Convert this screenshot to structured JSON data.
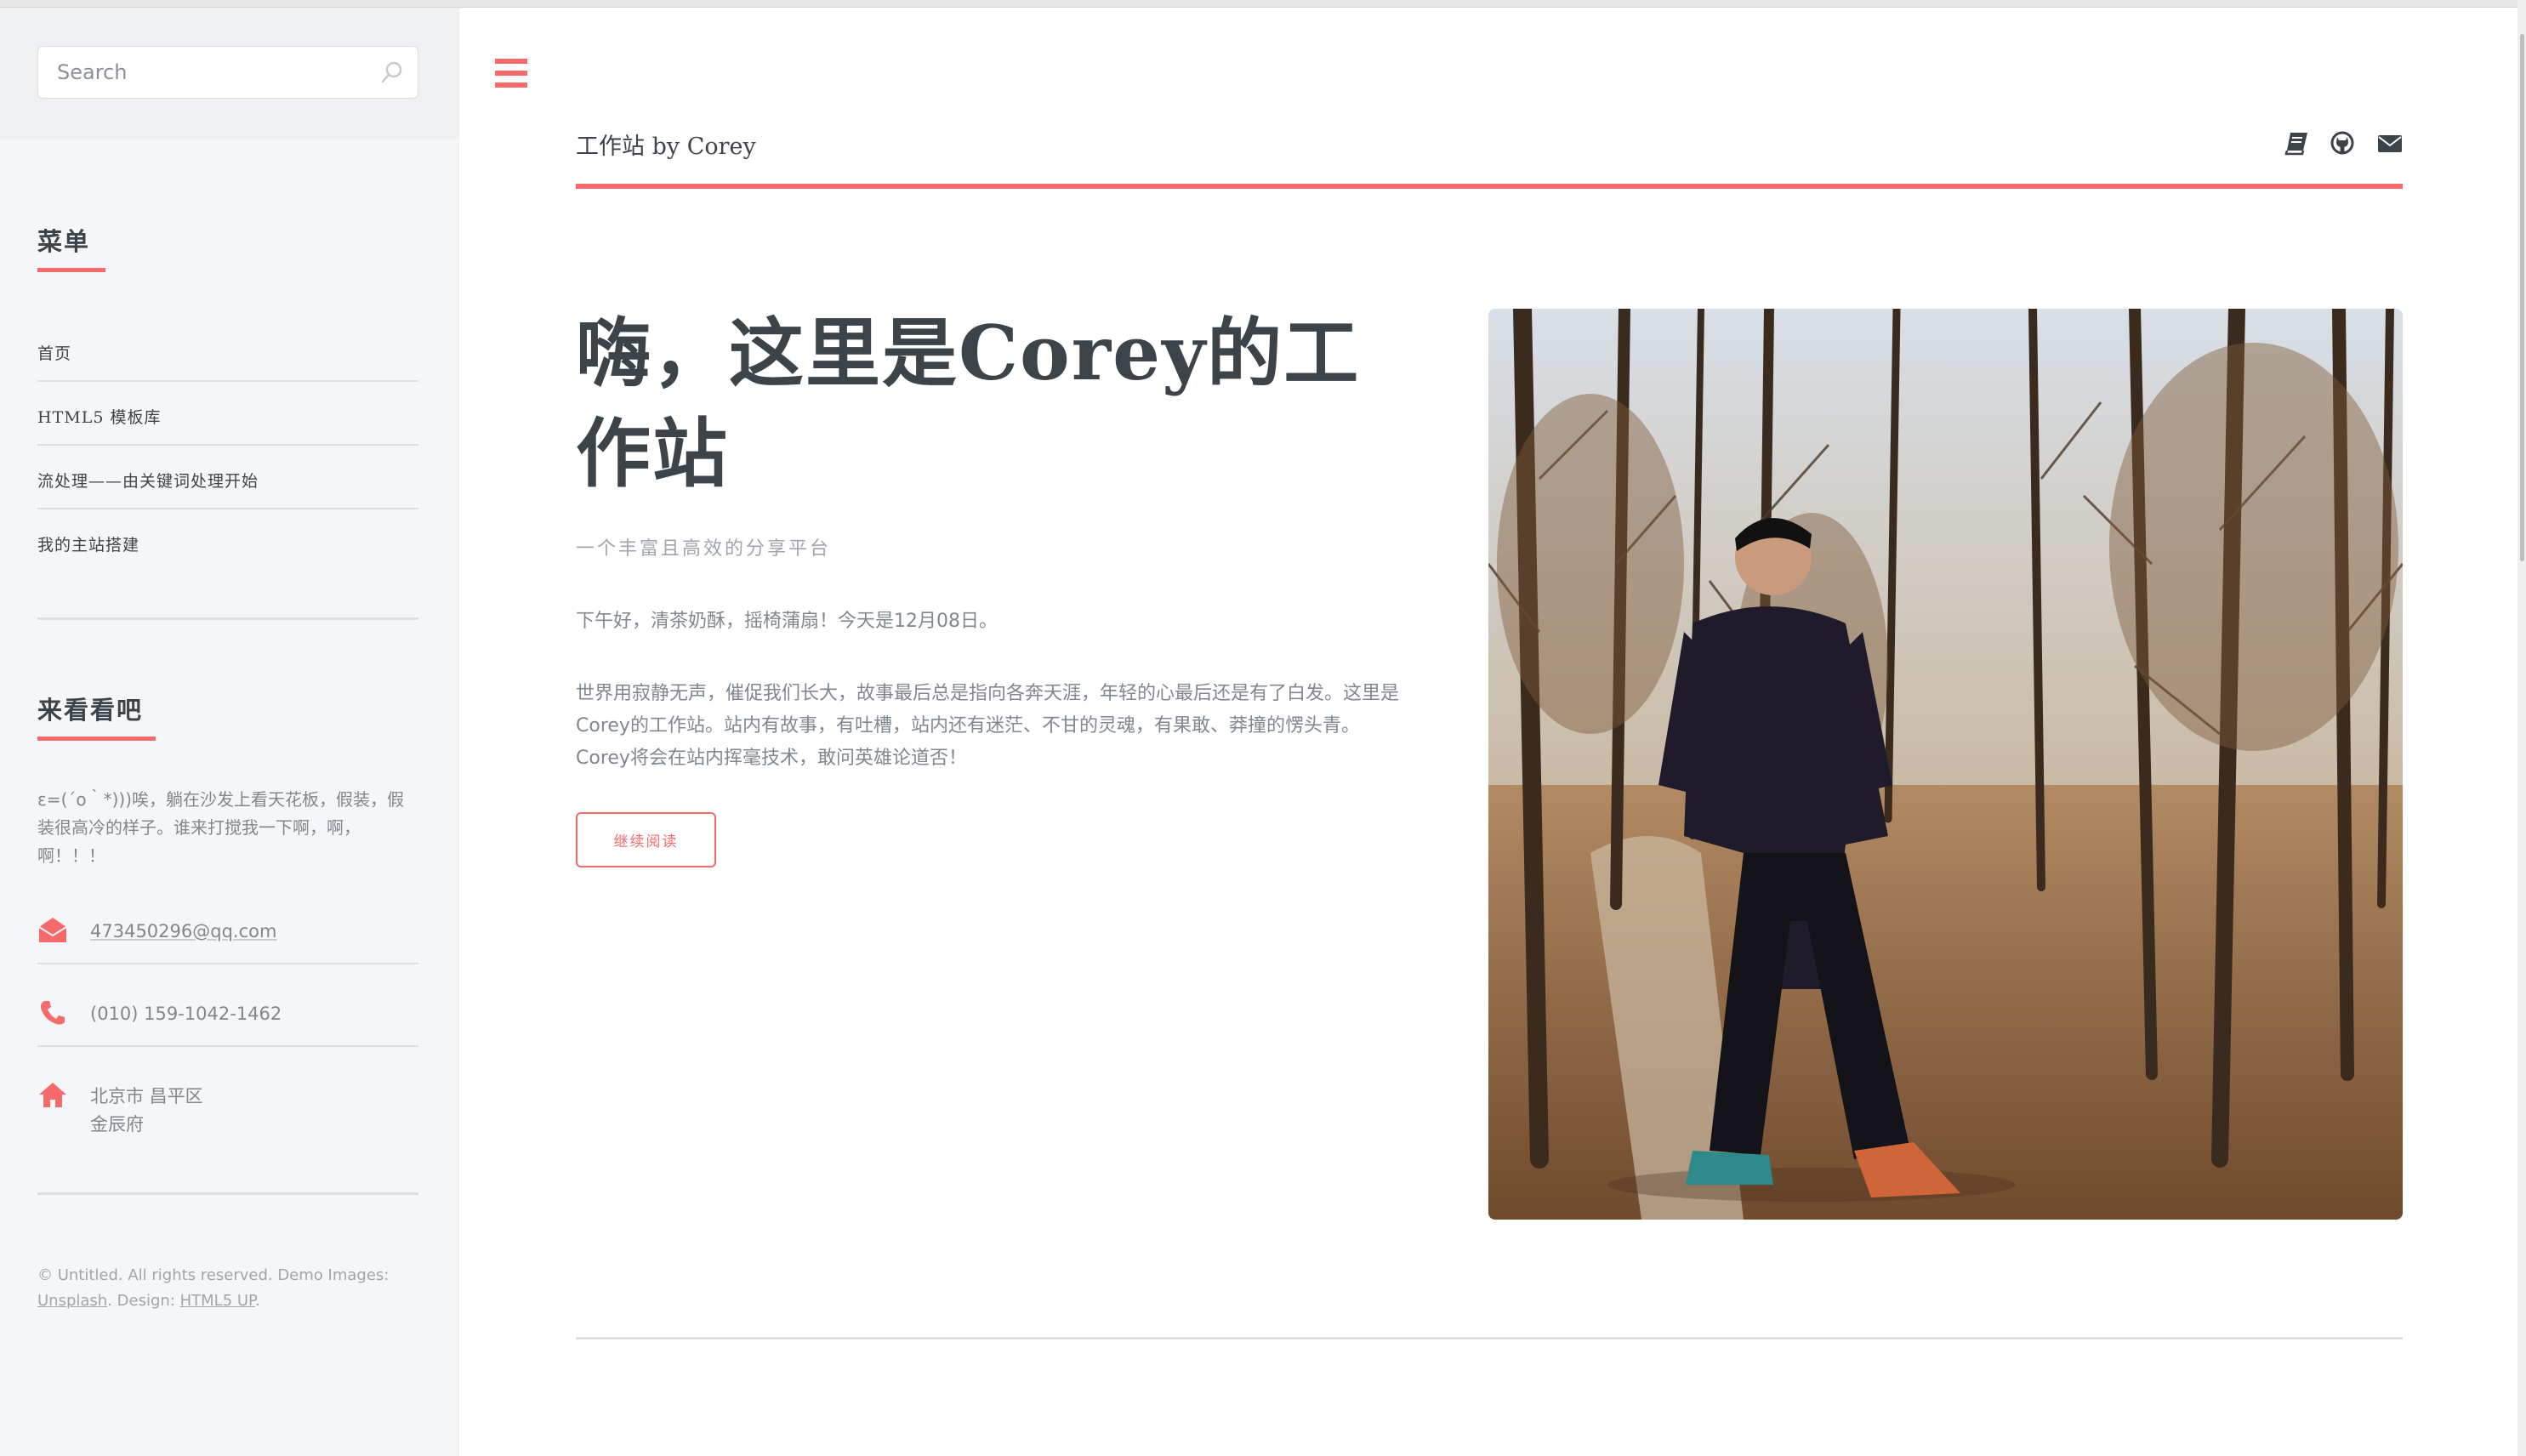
{
  "search": {
    "placeholder": "Search"
  },
  "sidebar": {
    "menu_heading": "菜单",
    "menu_items": [
      {
        "label": "首页"
      },
      {
        "label": "HTML5 模板库"
      },
      {
        "label": "流处理——由关键词处理开始"
      },
      {
        "label": "我的主站搭建"
      }
    ],
    "contact_heading": "来看看吧",
    "contact_text": "ε=(´ο｀*)))唉，躺在沙发上看天花板，假装，假装很高冷的样子。谁来打搅我一下啊，啊，啊！！！",
    "email": "473450296@qq.com",
    "phone": "(010) 159-1042-1462",
    "address_line1": "北京市 昌平区",
    "address_line2": "金辰府",
    "copyright_prefix": "© Untitled. All rights reserved. Demo Images: ",
    "copyright_link1": "Unsplash",
    "copyright_mid": ". Design: ",
    "copyright_link2": "HTML5 UP",
    "copyright_suffix": "."
  },
  "header": {
    "title": "工作站 by Corey",
    "icons": [
      "book-icon",
      "github-icon",
      "envelope-icon"
    ]
  },
  "banner": {
    "title": "嗨，这里是Corey的工作站",
    "subtitle": "一个丰富且高效的分享平台",
    "greeting": "下午好，清茶奶酥，摇椅蒲扇！今天是12月08日。",
    "body": "世界用寂静无声，催促我们长大，故事最后总是指向各奔天涯，年轻的心最后还是有了白发。这里是Corey的工作站。站内有故事，有吐槽，站内还有迷茫、不甘的灵魂，有果敢、莽撞的愣头青。Corey将会在站内挥毫技术，敢问英雄论道否！",
    "button_label": "继续阅读"
  },
  "colors": {
    "accent": "#f56a6a",
    "heading": "#3d4449",
    "text": "#7f888f"
  }
}
